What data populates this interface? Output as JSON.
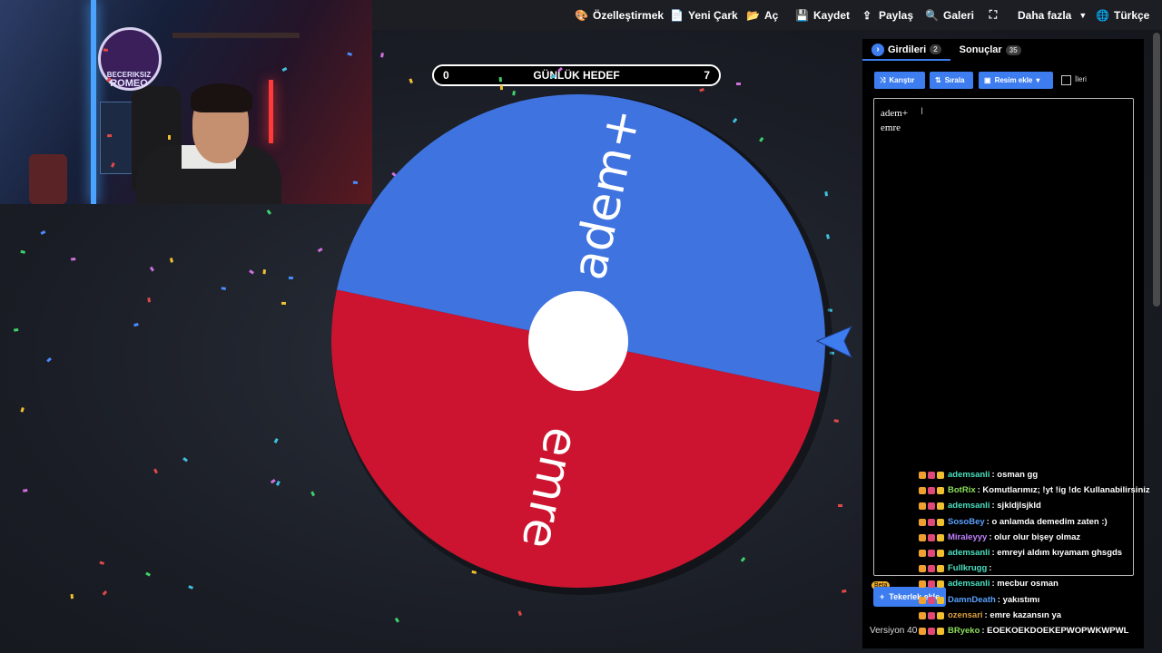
{
  "topbar": {
    "items": [
      {
        "icon": "palette-icon",
        "glyph": "🎨",
        "label": "Özelleştirmek"
      },
      {
        "icon": "file-icon",
        "glyph": "📄",
        "label": "Yeni Çark"
      },
      {
        "icon": "folder-open-icon",
        "glyph": "📂",
        "label": "Aç"
      },
      {
        "icon": "save-icon",
        "glyph": "💾",
        "label": "Kaydet"
      },
      {
        "icon": "share-icon",
        "glyph": "⇪",
        "label": "Paylaş"
      },
      {
        "icon": "search-icon",
        "glyph": "🔍",
        "label": "Galeri"
      },
      {
        "icon": "fullscreen-icon",
        "glyph": "⛶",
        "label": ""
      },
      {
        "icon": "chevron-down-icon",
        "glyph": "▾",
        "label": "Daha fazla"
      },
      {
        "icon": "globe-icon",
        "glyph": "🌐",
        "label": "Türkçe"
      }
    ]
  },
  "webcam": {
    "logo_top": "BECERIKSIZ",
    "logo_bottom": "ROMEO"
  },
  "goal": {
    "left": "0",
    "title": "GÜNLÜK HEDEF",
    "right": "7"
  },
  "wheel": {
    "segments": [
      {
        "label": "adem+",
        "color": "#3f73e0"
      },
      {
        "label": "emre",
        "color": "#cc1430"
      }
    ],
    "hub_color": "#ffffff",
    "pointer_color": "#3d7df0"
  },
  "panel": {
    "tabs": [
      {
        "label": "Girdileri",
        "count": "2"
      },
      {
        "label": "Sonuçlar",
        "count": "35"
      }
    ],
    "buttons": {
      "shuffle": "Karıştır",
      "sort": "Sırala",
      "add_image": "Resim ekle"
    },
    "advanced_label": "İleri",
    "entries": [
      "adem+",
      "emre"
    ],
    "add_wheel_label": "Tekerlek ekle",
    "beta_label": "Beta",
    "version_label": "Versiyon 40"
  },
  "chat": {
    "messages": [
      {
        "user": "ademsanli",
        "text": ": osman gg",
        "color": "#4be0c0"
      },
      {
        "user": "BotRix",
        "text": ": Komutlarımız; !yt !ig !dc Kullanabilirsiniz",
        "color": "#8de05a"
      },
      {
        "user": "ademsanli",
        "text": ": sjkldjlsjkld",
        "color": "#4be0c0"
      },
      {
        "user": "SosoBey",
        "text": ": o anlamda demedim zaten :)",
        "color": "#5aa0ff"
      },
      {
        "user": "Miraleyyy",
        "text": ": olur olur bişey olmaz",
        "color": "#c080ff"
      },
      {
        "user": "ademsanli",
        "text": ": emreyi aldım kıyamam ghsgds",
        "color": "#4be0c0"
      },
      {
        "user": "Fullkrugg",
        "text": ":",
        "color": "#4be0c0"
      },
      {
        "user": "ademsanli",
        "text": ": mecbur osman",
        "color": "#4be0c0"
      },
      {
        "user": "DamnDeath",
        "text": ": yakıstımı",
        "color": "#5aa0ff"
      },
      {
        "user": "ozensari",
        "text": ": emre kazansın ya",
        "color": "#e0a040"
      },
      {
        "user": "BRyeko",
        "text": ": EOEKOEKDOEKEPWOPWKWPWL",
        "color": "#8de05a"
      }
    ]
  }
}
